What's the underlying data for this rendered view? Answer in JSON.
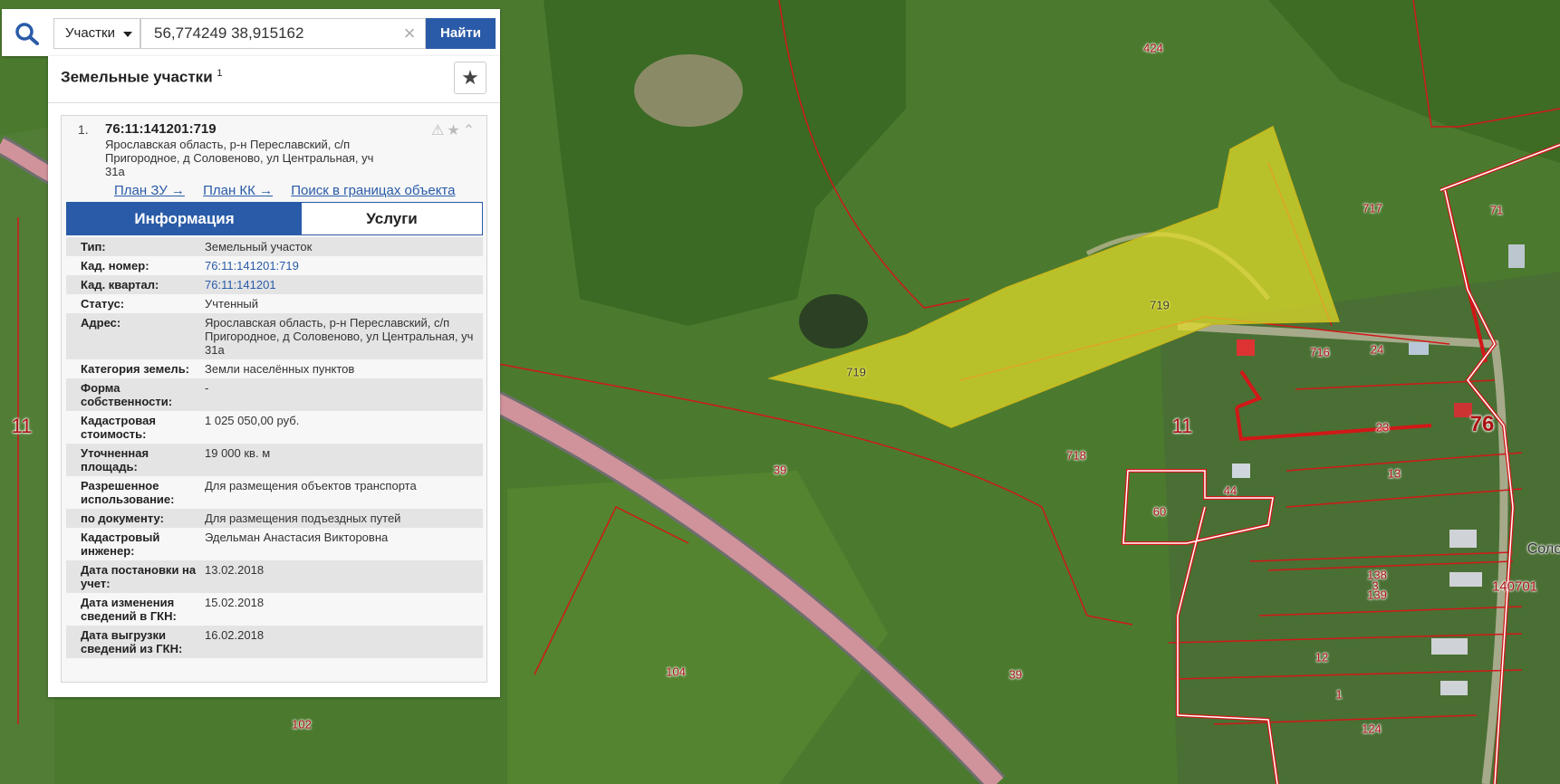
{
  "search": {
    "category": "Участки",
    "query": "56,774249 38,915162",
    "clear_symbol": "×",
    "find_label": "Найти"
  },
  "panel": {
    "title": "Земельные участки",
    "count": "1",
    "star_symbol": "★"
  },
  "result": {
    "index": "1.",
    "cad_number": "76:11:141201:719",
    "address": "Ярославская область, р-н Переславский, с/п Пригородное, д Соловеново, ул Центральная, уч 31а",
    "icons": "⚠★⌃",
    "links": [
      "План ЗУ →",
      "План КК →",
      "Поиск в границах объекта →"
    ],
    "tabs": [
      "Информация",
      "Услуги"
    ],
    "active_tab": "Информация"
  },
  "info": [
    {
      "key": "Тип:",
      "value": "Земельный участок",
      "link": false
    },
    {
      "key": "Кад. номер:",
      "value": "76:11:141201:719",
      "link": true
    },
    {
      "key": "Кад. квартал:",
      "value": "76:11:141201",
      "link": true
    },
    {
      "key": "Статус:",
      "value": "Учтенный",
      "link": false
    },
    {
      "key": "Адрес:",
      "value": "Ярославская область, р-н Переславский, с/п Пригородное, д Соловеново, ул Центральная, уч 31а",
      "link": false
    },
    {
      "key": "Категория земель:",
      "value": "Земли населённых пунктов",
      "link": false
    },
    {
      "key": "Форма собственности:",
      "value": "-",
      "link": false
    },
    {
      "key": "Кадастровая стоимость:",
      "value": "1 025 050,00 руб.",
      "link": false
    },
    {
      "key": "Уточненная площадь:",
      "value": "19 000 кв. м",
      "link": false
    },
    {
      "key": "Разрешенное использование:",
      "value": "Для размещения объектов транспорта",
      "link": false
    },
    {
      "key": "по документу:",
      "value": "Для размещения подъездных путей",
      "link": false
    },
    {
      "key": "Кадастровый инженер:",
      "value": "Эдельман Анастасия Викторовна",
      "link": false
    },
    {
      "key": "Дата постановки на учет:",
      "value": "13.02.2018",
      "link": false
    },
    {
      "key": "Дата изменения сведений в ГКН:",
      "value": "15.02.2018",
      "link": false
    },
    {
      "key": "Дата выгрузки сведений из ГКН:",
      "value": "16.02.2018",
      "link": false
    }
  ],
  "map": {
    "labels": [
      "424",
      "717",
      "71",
      "719",
      "719",
      "716",
      "24",
      "11",
      "76",
      "23",
      "13",
      "44",
      "718",
      "39",
      "60",
      "Соло",
      "138",
      "3",
      "140701",
      "139",
      "12",
      "1",
      "124",
      "104",
      "39",
      "102",
      "11"
    ],
    "selected_parcel_color": "#e3dc2a",
    "boundary_color": "#d01818"
  }
}
